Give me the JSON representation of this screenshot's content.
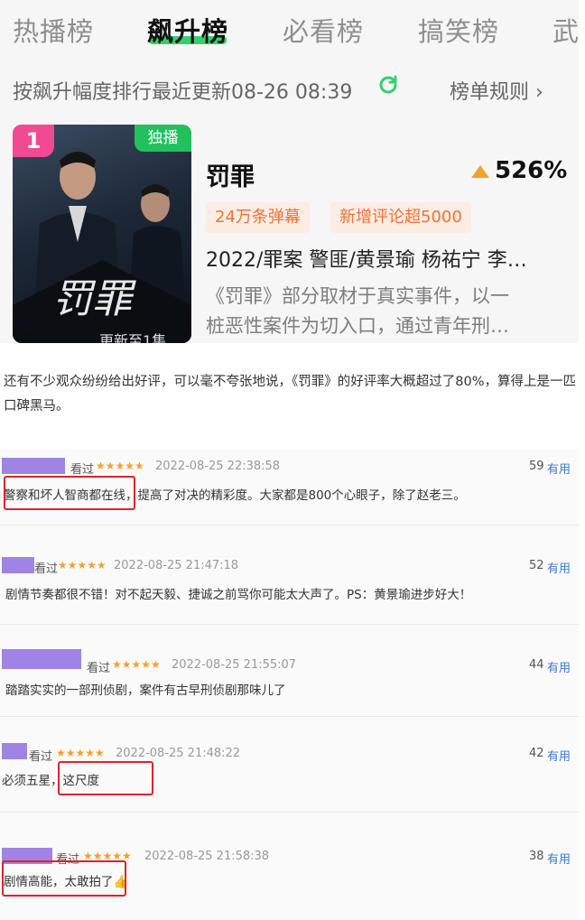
{
  "tabs": [
    "热播榜",
    "飙升榜",
    "必看榜",
    "搞笑榜",
    "武"
  ],
  "active_tab": "飙升榜",
  "subbar": {
    "update_text": "按飙升幅度排行最近更新08-26 08:39",
    "rules_label": "榜单规则 ›"
  },
  "show": {
    "rank": "1",
    "exclusive_badge": "独播",
    "poster_text": "罚罪",
    "poster_cut_text": "更新至1集",
    "title": "罚罪",
    "rise_percent": "526%",
    "tags": [
      "24万条弹幕",
      "新增评论超5000"
    ],
    "meta": "2022/罪案 警匪/黄景瑜 杨祐宁 李…",
    "desc_line1": "《罚罪》部分取材于真实事件，以一",
    "desc_line2": "桩恶性案件为切入口，通过青年刑…"
  },
  "article": {
    "text": "还有不少观众纷纷给出好评，可以毫不夸张地说，《罚罪》的好评率大概超过了80%，算得上是一匹口碑黑马。"
  },
  "reviews": [
    {
      "watched": "看过",
      "stars": "★★★★★",
      "time": "2022-08-25 22:38:58",
      "useful_count": "59",
      "useful_label": "有用",
      "text": "警察和坏人智商都在线，提高了对决的精彩度。大家都是800个心眼子，除了赵老三。"
    },
    {
      "watched": "看过",
      "stars": "★★★★★",
      "time": "2022-08-25 21:47:18",
      "useful_count": "52",
      "useful_label": "有用",
      "text": "剧情节奏都很不错！对不起天毅、捷诚之前骂你可能太大声了。PS：黄景瑜进步好大！"
    },
    {
      "watched": "看过",
      "stars": "★★★★★",
      "time": "2022-08-25 21:55:07",
      "useful_count": "44",
      "useful_label": "有用",
      "text": "踏踏实实的一部刑侦剧，案件有古早刑侦剧那味儿了"
    },
    {
      "watched": "看过",
      "stars": "★★★★★",
      "time": "2022-08-25 21:48:22",
      "useful_count": "42",
      "useful_label": "有用",
      "text": "必须五星，这尺度"
    },
    {
      "watched": "看过",
      "stars": "★★★★★",
      "time": "2022-08-25 21:58:38",
      "useful_count": "38",
      "useful_label": "有用",
      "text": "剧情高能，太敢拍了👍"
    }
  ],
  "colors": {
    "accent_green": "#35d06e",
    "rank_pink": "#f04a92",
    "tag_orange": "#ee7439",
    "highlight_red": "#d8262a",
    "avatar_purple": "#9f84e6",
    "star_gold": "#f2a12d"
  },
  "icons": [
    "refresh-icon",
    "triangle-up-icon",
    "chevron-right-icon",
    "star-icon",
    "thumbs-up-emoji"
  ]
}
